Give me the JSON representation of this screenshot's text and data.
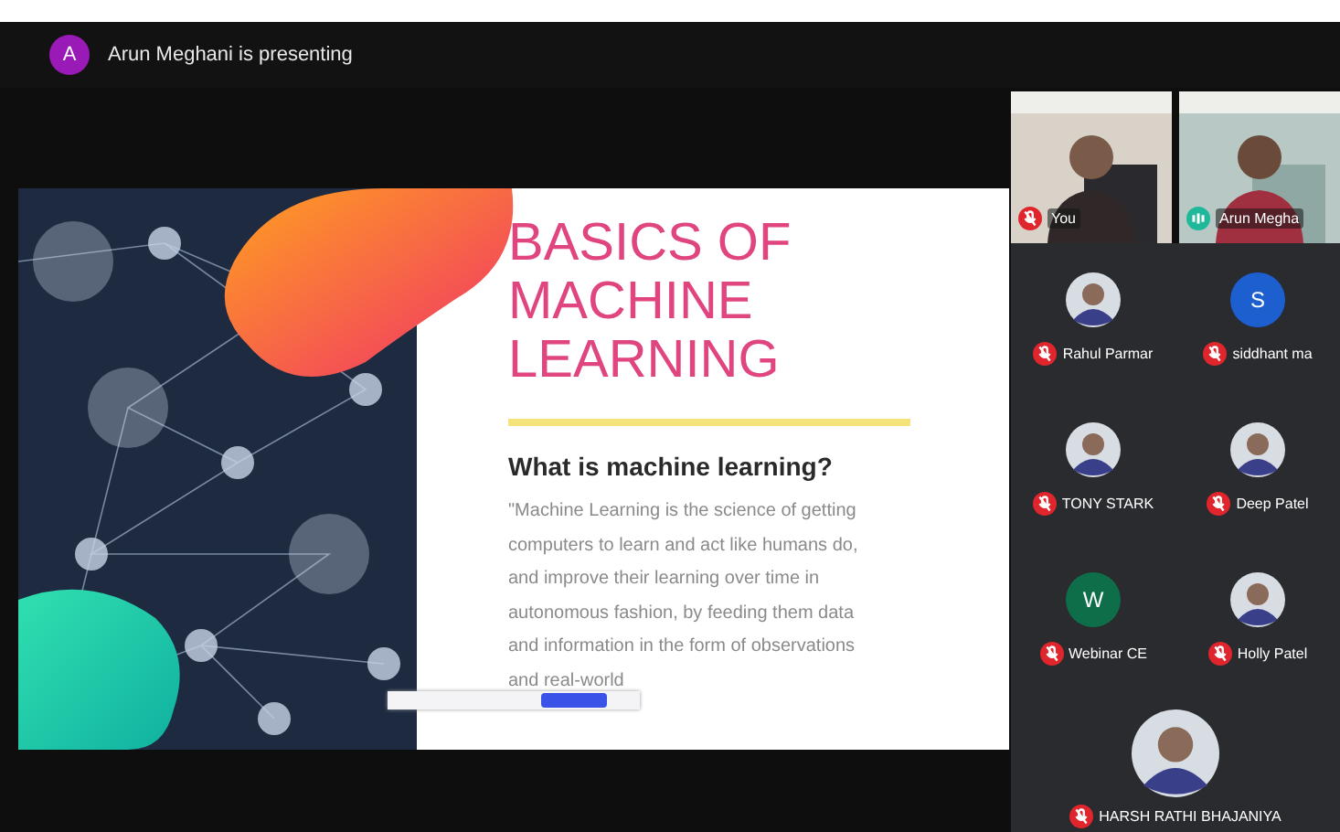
{
  "presenter": {
    "initial": "A",
    "text": "Arun Meghani is presenting"
  },
  "slide": {
    "title": "BASICS OF MACHINE LEARNING",
    "subtitle": "What is machine learning?",
    "body": "\"Machine Learning is the science of getting computers to learn and act like humans do, and improve their learning over time in autonomous fashion, by feeding them data and information in the form of observations and real-world"
  },
  "participants": [
    {
      "name": "You",
      "kind": "video",
      "muted": true
    },
    {
      "name": "Arun Megha",
      "kind": "video",
      "muted": false
    },
    {
      "name": "Rahul Parmar",
      "muted": true
    },
    {
      "name": "siddhant ma",
      "kind": "initial",
      "initial": "S",
      "color": "#1e5fd0",
      "muted": true
    },
    {
      "name": "TONY STARK",
      "muted": true
    },
    {
      "name": "Deep Patel",
      "muted": true
    },
    {
      "name": "Webinar CE",
      "kind": "initial",
      "initial": "W",
      "color": "#0f6e4a",
      "muted": true
    },
    {
      "name": "Holly Patel",
      "muted": true
    },
    {
      "name": "HARSH RATHI BHAJANIYA",
      "muted": true
    }
  ]
}
